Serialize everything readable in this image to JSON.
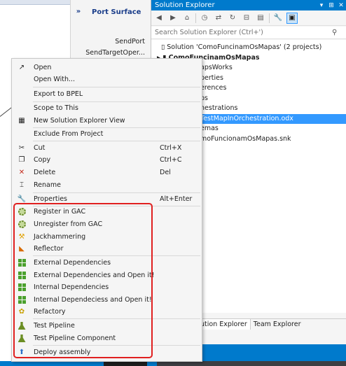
{
  "port_surface": {
    "toggle": "»",
    "title": "Port Surface",
    "items": [
      "SendPort",
      "SendTargetOper..."
    ]
  },
  "solution_explorer": {
    "title": "Solution Explorer",
    "title_controls": [
      "▾",
      "⊞",
      "✕"
    ],
    "search_placeholder": "Search Solution Explorer (Ctrl+')",
    "tree": [
      {
        "text": "Solution 'ComoFuncinamOsMapas' (2 projects)",
        "bold": false,
        "selected": false
      },
      {
        "text": "ComoFuncinamOsMapas",
        "bold": true,
        "selected": false
      },
      {
        "text": "apsWorks",
        "bold": false,
        "selected": false
      },
      {
        "text": "perties",
        "bold": false,
        "selected": false
      },
      {
        "text": "erences",
        "bold": false,
        "selected": false
      },
      {
        "text": "ps",
        "bold": false,
        "selected": false
      },
      {
        "text": "hestrations",
        "bold": false,
        "selected": false
      },
      {
        "text": "TestMapInOrchestration.odx",
        "bold": false,
        "selected": true
      },
      {
        "text": "emas",
        "bold": false,
        "selected": false
      },
      {
        "text": "moFuncionamOsMapas.snk",
        "bold": false,
        "selected": false
      }
    ],
    "tabs": [
      "Solution Explorer",
      "Team Explorer"
    ],
    "tab_visible_text": [
      "ution Explorer",
      "Team Explorer"
    ]
  },
  "context_menu": {
    "items": [
      {
        "label": "Open",
        "shortcut": "",
        "icon": "open-icon"
      },
      {
        "label": "Open With...",
        "shortcut": "",
        "icon": ""
      },
      {
        "label": "Export to BPEL",
        "shortcut": "",
        "icon": ""
      },
      {
        "label": "Scope to This",
        "shortcut": "",
        "icon": ""
      },
      {
        "label": "New Solution Explorer View",
        "shortcut": "",
        "icon": "new-view-icon"
      },
      {
        "label": "Exclude From Project",
        "shortcut": "",
        "icon": ""
      },
      {
        "label": "Cut",
        "shortcut": "Ctrl+X",
        "icon": "cut-icon"
      },
      {
        "label": "Copy",
        "shortcut": "Ctrl+C",
        "icon": "copy-icon"
      },
      {
        "label": "Delete",
        "shortcut": "Del",
        "icon": "delete-icon"
      },
      {
        "label": "Rename",
        "shortcut": "",
        "icon": "rename-icon"
      },
      {
        "label": "Properties",
        "shortcut": "Alt+Enter",
        "icon": "wrench-icon"
      },
      {
        "label": "Register in GAC",
        "shortcut": "",
        "icon": "gac-register-icon"
      },
      {
        "label": "Unregister from GAC",
        "shortcut": "",
        "icon": "gac-unregister-icon"
      },
      {
        "label": "Jackhammering",
        "shortcut": "",
        "icon": "jackhammer-icon"
      },
      {
        "label": "Reflector",
        "shortcut": "",
        "icon": "reflector-icon"
      },
      {
        "label": "External Dependencies",
        "shortcut": "",
        "icon": "dependencies-icon"
      },
      {
        "label": "External Dependencies and Open it!",
        "shortcut": "",
        "icon": "dependencies-icon"
      },
      {
        "label": "Internal Dependencies",
        "shortcut": "",
        "icon": "dependencies-icon"
      },
      {
        "label": "Internal Dependeciess and Open it!",
        "shortcut": "",
        "icon": "dependencies-icon"
      },
      {
        "label": "Refactory",
        "shortcut": "",
        "icon": "refactory-icon"
      },
      {
        "label": "Test Pipeline",
        "shortcut": "",
        "icon": "test-pipeline-icon"
      },
      {
        "label": "Test Pipeline Component",
        "shortcut": "",
        "icon": "test-pipeline-icon"
      },
      {
        "label": "Deploy assembly",
        "shortcut": "",
        "icon": "deploy-icon"
      }
    ]
  },
  "colors": {
    "accent": "#007acc",
    "selection": "#3399ff",
    "highlight_box": "#e02020"
  }
}
